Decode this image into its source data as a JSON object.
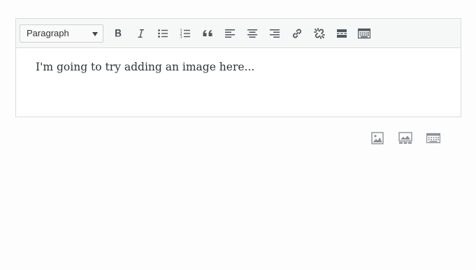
{
  "toolbar": {
    "format_select": {
      "value": "Paragraph"
    },
    "buttons": [
      {
        "icon": "bold-icon"
      },
      {
        "icon": "italic-icon"
      },
      {
        "icon": "bulleted-list-icon"
      },
      {
        "icon": "numbered-list-icon"
      },
      {
        "icon": "blockquote-icon"
      },
      {
        "icon": "align-left-icon"
      },
      {
        "icon": "align-center-icon"
      },
      {
        "icon": "align-right-icon"
      },
      {
        "icon": "insert-link-icon"
      },
      {
        "icon": "remove-link-icon"
      },
      {
        "icon": "read-more-icon"
      },
      {
        "icon": "toolbar-toggle-icon"
      }
    ]
  },
  "editor": {
    "text": "I'm going to try adding an image here..."
  },
  "block_icons": [
    {
      "icon": "image-icon"
    },
    {
      "icon": "gallery-icon"
    },
    {
      "icon": "toolbar-toggle-icon"
    }
  ],
  "colors": {
    "icon": "#50575e",
    "toolbar_bg": "#f6f7f7",
    "border": "#dcdcde",
    "text": "#2c3338"
  }
}
